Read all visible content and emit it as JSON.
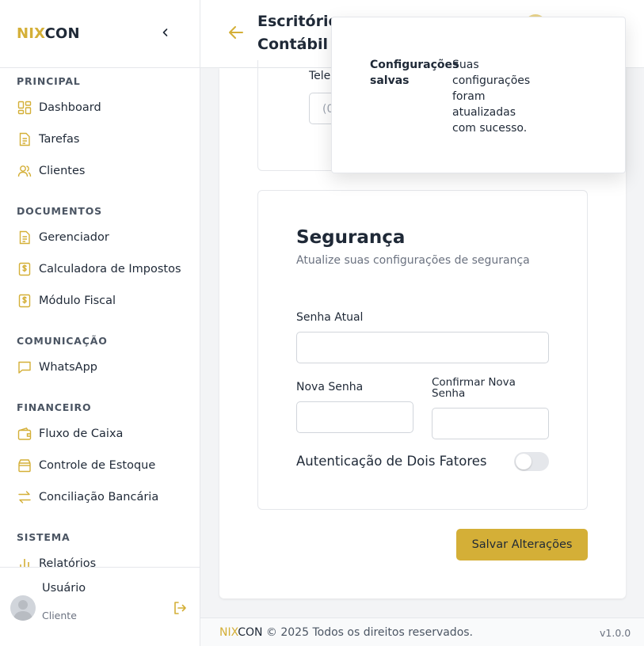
{
  "brand": {
    "part1": "NIX",
    "part2": "CON"
  },
  "sidebar": {
    "sections": [
      {
        "title": "PRINCIPAL",
        "items": [
          {
            "label": "Dashboard",
            "icon": "dashboard-icon"
          },
          {
            "label": "Tarefas",
            "icon": "document-icon"
          },
          {
            "label": "Clientes",
            "icon": "users-icon"
          }
        ]
      },
      {
        "title": "DOCUMENTOS",
        "items": [
          {
            "label": "Gerenciador",
            "icon": "document-icon"
          },
          {
            "label": "Calculadora de Impostos",
            "icon": "dollar-doc-icon"
          },
          {
            "label": "Módulo Fiscal",
            "icon": "dollar-doc-icon"
          }
        ]
      },
      {
        "title": "COMUNICAÇÃO",
        "items": [
          {
            "label": "WhatsApp",
            "icon": "chat-icon"
          }
        ]
      },
      {
        "title": "FINANCEIRO",
        "items": [
          {
            "label": "Fluxo de Caixa",
            "icon": "wallet-icon"
          },
          {
            "label": "Controle de Estoque",
            "icon": "box-icon"
          },
          {
            "label": "Conciliação Bancária",
            "icon": "swap-icon"
          }
        ]
      },
      {
        "title": "SISTEMA",
        "items": [
          {
            "label": "Relatórios",
            "icon": "bar-chart-icon"
          }
        ]
      }
    ]
  },
  "user": {
    "name": "Usuário",
    "role": "Cliente"
  },
  "header": {
    "title": "Escritório Contábil"
  },
  "contact_card": {
    "phone_label": "Tele",
    "phone_placeholder": "(0"
  },
  "security": {
    "title": "Segurança",
    "subtitle": "Atualize suas configurações de segurança",
    "current_password_label": "Senha Atual",
    "new_password_label": "Nova Senha",
    "confirm_password_label": "Confirmar Nova Senha",
    "two_factor_label": "Autenticação de Dois Fatores",
    "two_factor_enabled": false
  },
  "save_button": "Salvar Alterações",
  "footer": {
    "copyright": "© 2025 Todos os direitos reservados.",
    "version": "v1.0.0"
  },
  "toast": {
    "title": "Configurações salvas",
    "message": "Suas configurações foram atualizadas com sucesso."
  },
  "colors": {
    "accent": "#d4af37",
    "text": "#1f2937",
    "muted": "#6b7280",
    "border": "#e5e7eb"
  }
}
